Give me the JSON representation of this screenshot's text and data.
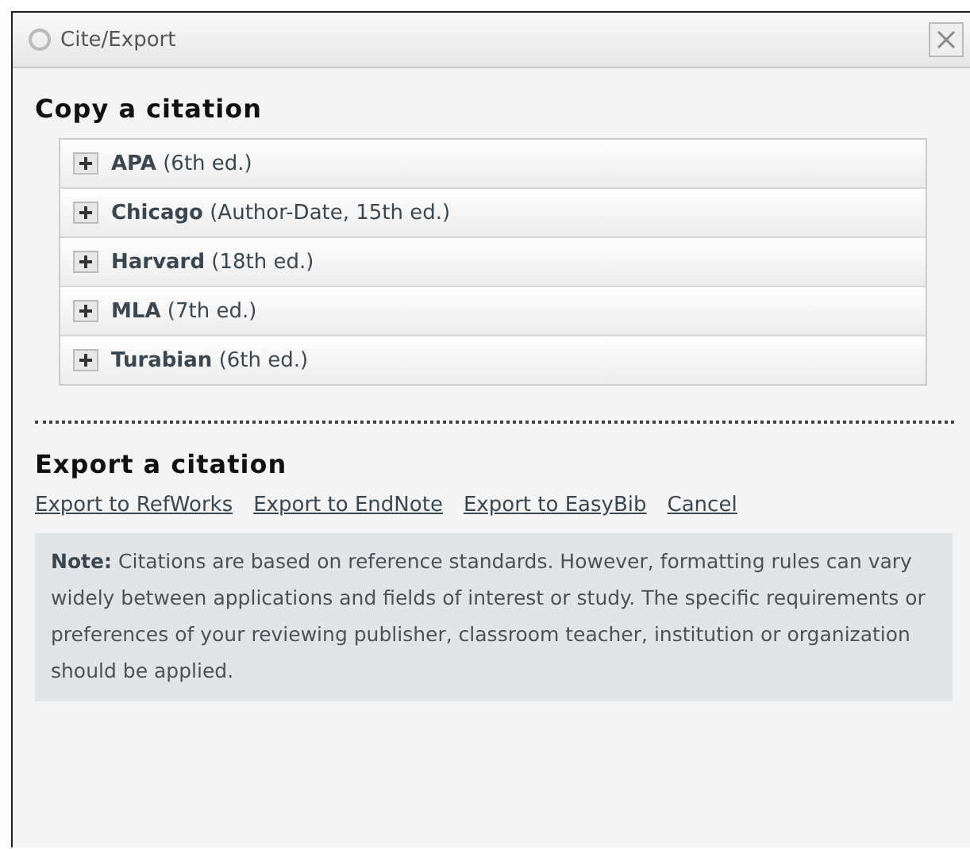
{
  "window": {
    "title": "Cite/Export"
  },
  "copy_section": {
    "heading": "Copy a citation",
    "styles": [
      {
        "name": "APA",
        "edition": "(6th ed.)",
        "expanded": false
      },
      {
        "name": "Chicago",
        "edition": "(Author-Date, 15th ed.)",
        "expanded": false
      },
      {
        "name": "Harvard",
        "edition": "(18th ed.)",
        "expanded": false
      },
      {
        "name": "MLA",
        "edition": "(7th ed.)",
        "expanded": false
      },
      {
        "name": "Turabian",
        "edition": "(6th ed.)",
        "expanded": false
      }
    ]
  },
  "export_section": {
    "heading": "Export a citation",
    "links": [
      "Export to RefWorks",
      "Export to EndNote",
      "Export to EasyBib",
      "Cancel"
    ]
  },
  "note": "**Note:** Citations are based on reference standards. However, formatting rules can vary widely between applications and fields of interest or study. The specific requirements or preferences of your reviewing publisher, classroom teacher, institution or organization should be applied."
}
